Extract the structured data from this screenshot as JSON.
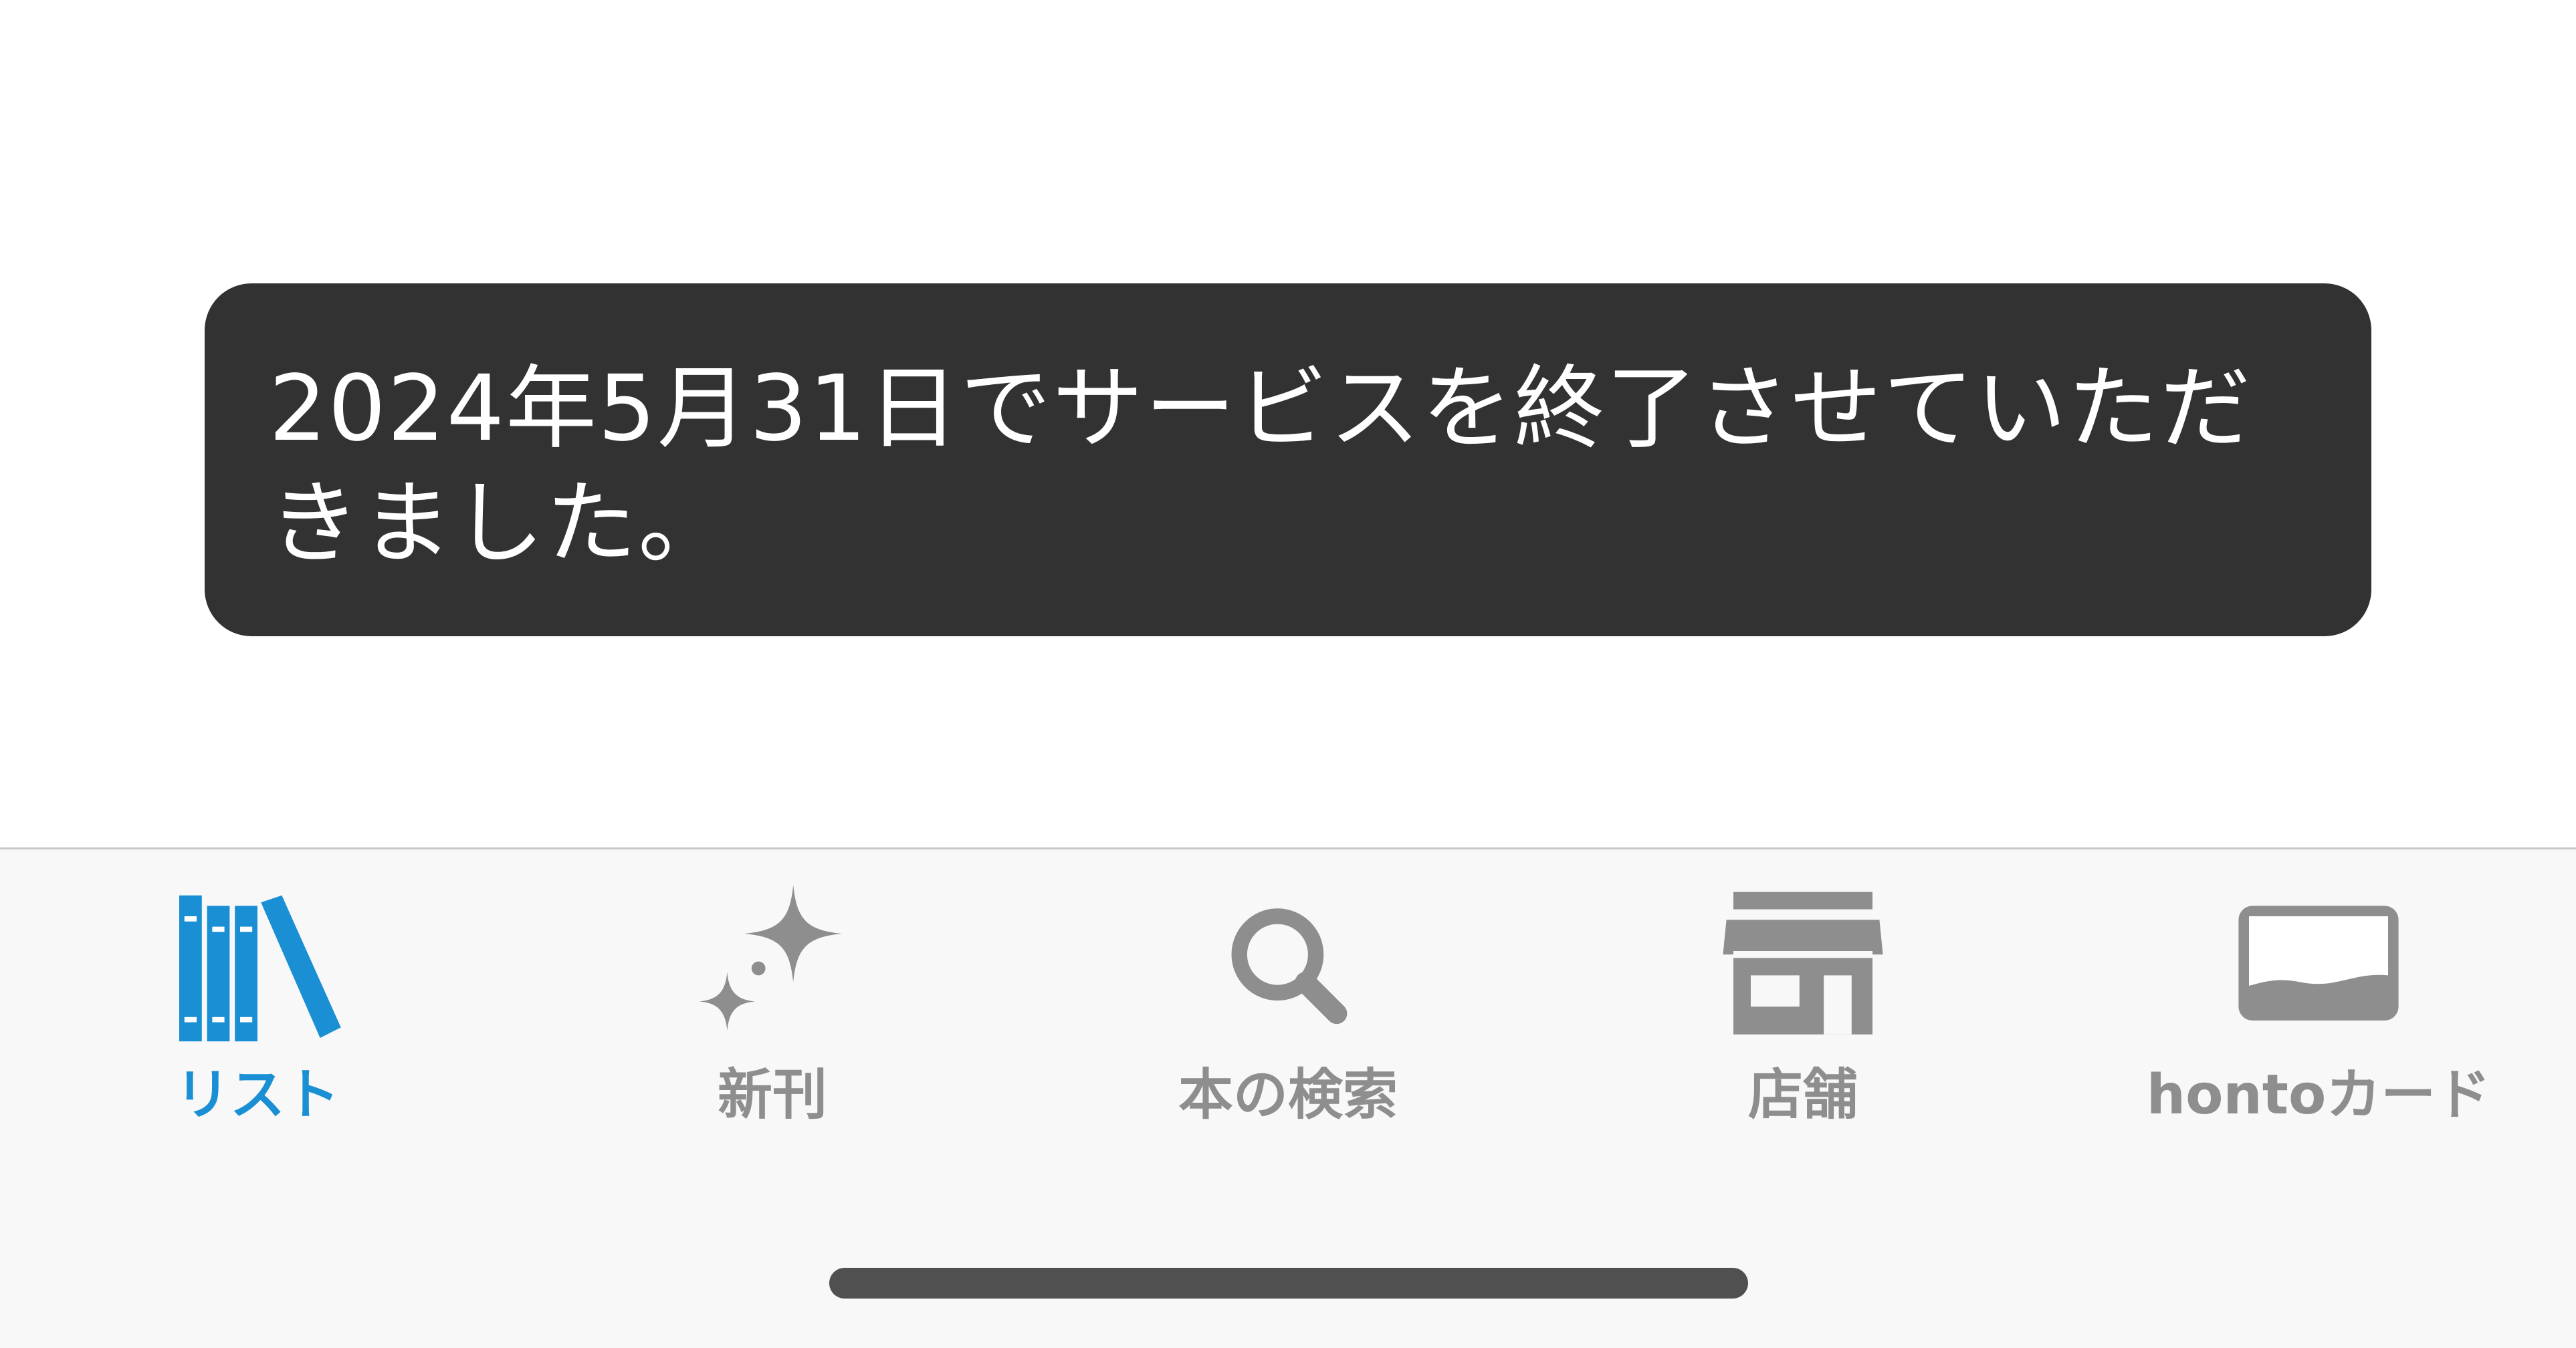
{
  "toast": {
    "message": "2024年5月31日でサービスを終了させていただきました。"
  },
  "tabbar": {
    "active_color": "#1a8fd4",
    "inactive_color": "#8e8e8e",
    "tabs": [
      {
        "label": "リスト",
        "icon": "bookshelf-icon",
        "active": true
      },
      {
        "label": "新刊",
        "icon": "sparkle-icon",
        "active": false
      },
      {
        "label": "本の検索",
        "icon": "search-icon",
        "active": false
      },
      {
        "label": "店舗",
        "icon": "store-icon",
        "active": false
      },
      {
        "label": "hontoカード",
        "icon": "card-icon",
        "active": false
      }
    ]
  }
}
